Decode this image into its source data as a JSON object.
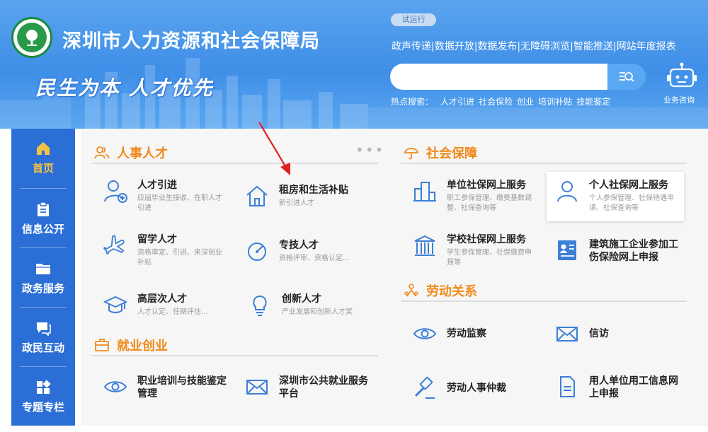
{
  "header": {
    "title": "深圳市人力资源和社会保障局",
    "slogan": "民生为本  人才优先",
    "trial_badge": "试运行",
    "top_links": [
      "政声传递|",
      "数据开放|",
      "数据发布|",
      "无障碍浏览|",
      "智能推送|",
      "网站年度报表"
    ],
    "search": {
      "placeholder": ""
    },
    "hot_search_label": "热点搜索：",
    "hot_search_items": [
      "人才引进",
      "社会保险",
      "创业",
      "培训补贴",
      "技能鉴定"
    ],
    "robot_label": "业务咨询"
  },
  "sidebar": {
    "items": [
      {
        "label": "首页",
        "icon": "home-icon",
        "active": true
      },
      {
        "label": "信息公开",
        "icon": "clipboard-icon",
        "active": false
      },
      {
        "label": "政务服务",
        "icon": "folder-icon",
        "active": false
      },
      {
        "label": "政民互动",
        "icon": "chat-icon",
        "active": false
      },
      {
        "label": "专题专栏",
        "icon": "grid-icon",
        "active": false
      }
    ]
  },
  "sections": {
    "talent": {
      "title": "人事人才",
      "more": "•••",
      "items": [
        {
          "title": "人才引进",
          "desc": "应届毕业生接收、在职人才引进",
          "icon": "person-add-icon"
        },
        {
          "title": "租房和生活补贴",
          "desc": "新引进人才",
          "icon": "house-icon"
        },
        {
          "title": "留学人才",
          "desc": "资格审定、引进、来深创业补贴",
          "icon": "airplane-icon"
        },
        {
          "title": "专技人才",
          "desc": "资格评审、资格认定...",
          "icon": "gauge-icon"
        },
        {
          "title": "高层次人才",
          "desc": "人才认定、任期评估...",
          "icon": "graduation-cap-icon"
        },
        {
          "title": "创新人才",
          "desc": "产业发展和创新人才奖",
          "icon": "lightbulb-icon"
        }
      ]
    },
    "employment": {
      "title": "就业创业",
      "items": [
        {
          "title": "职业培训与技能鉴定管理",
          "icon": "eye-icon"
        },
        {
          "title": "深圳市公共就业服务平台",
          "icon": "mail-icon"
        }
      ]
    },
    "social": {
      "title": "社会保障",
      "items": [
        {
          "title": "单位社保网上服务",
          "desc": "职工参保管理、缴费基数调整、社保查询等",
          "icon": "building-chart-icon"
        },
        {
          "title": "个人社保网上服务",
          "desc": "个人参保管理、社保待遇申请、社保查询等",
          "icon": "person-icon"
        },
        {
          "title": "学校社保网上服务",
          "desc": "学生参保管理、社保缴费申报等",
          "icon": "school-icon"
        },
        {
          "title": "建筑施工企业参加工伤保险网上申报",
          "icon": "id-card-icon"
        }
      ]
    },
    "labor": {
      "title": "劳动关系",
      "items": [
        {
          "title": "劳动监察",
          "icon": "eye-icon"
        },
        {
          "title": "信访",
          "icon": "mail-icon"
        },
        {
          "title": "劳动人事仲裁",
          "icon": "gavel-icon"
        },
        {
          "title": "用人单位用工信息网上申报",
          "icon": "document-icon"
        }
      ]
    }
  },
  "colors": {
    "header_blue": "#3f8fe8",
    "sidebar_blue": "#2b6fd6",
    "active_yellow": "#f5c242",
    "section_orange": "#f08a1a",
    "icon_blue": "#3c7fd8",
    "annotation_red": "#e02020"
  }
}
